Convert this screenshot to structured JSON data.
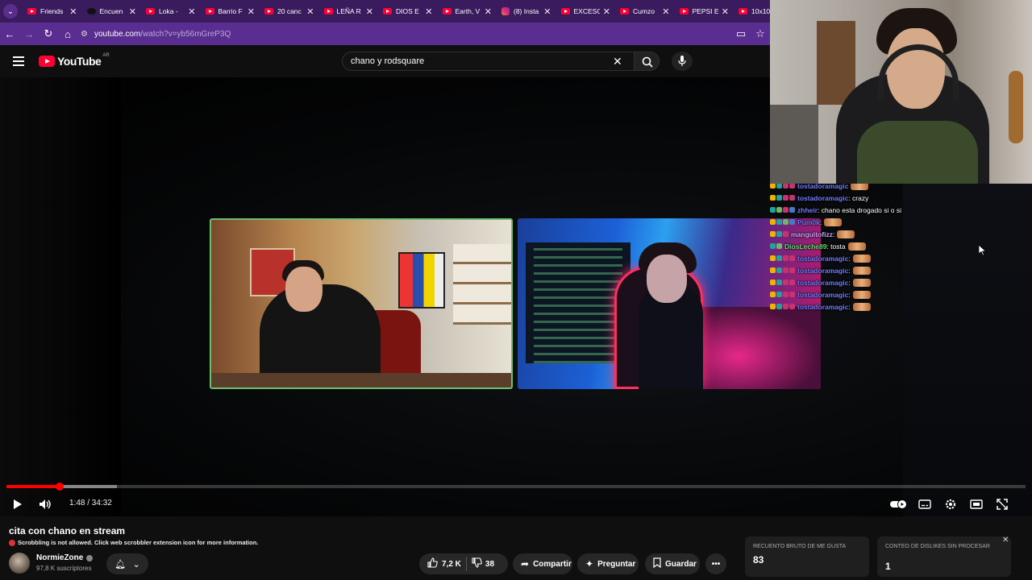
{
  "browser": {
    "tabs": [
      {
        "label": "Friends",
        "icon": "youtube-icon"
      },
      {
        "label": "Encuen",
        "icon": "tiktok-icon"
      },
      {
        "label": "Loka - ",
        "icon": "youtube-icon"
      },
      {
        "label": "Barrio F",
        "icon": "youtube-icon"
      },
      {
        "label": "20 canc",
        "icon": "youtube-icon"
      },
      {
        "label": "LEÑA R",
        "icon": "youtube-icon"
      },
      {
        "label": "DIOS E",
        "icon": "youtube-icon"
      },
      {
        "label": "Earth, V",
        "icon": "youtube-icon"
      },
      {
        "label": "(8) Insta",
        "icon": "instagram-icon"
      },
      {
        "label": "EXCESO",
        "icon": "youtube-icon"
      },
      {
        "label": "Cumzo",
        "icon": "youtube-icon"
      },
      {
        "label": "PEPSI E",
        "icon": "youtube-icon"
      },
      {
        "label": "10x10",
        "icon": "youtube-icon"
      }
    ],
    "url_host": "youtube.com",
    "url_path": "/watch?v=yb56mGreP3Q"
  },
  "masthead": {
    "logo_text": "YouTube",
    "country": "AR",
    "search_value": "chano y rodsquare"
  },
  "chat": [
    {
      "user": "tostadoramagic",
      "color": "#6f7cff",
      "message": "",
      "emote": true,
      "badges": [
        "y",
        "t",
        "p",
        "p"
      ]
    },
    {
      "user": "tostadoramagic",
      "color": "#6f7cff",
      "message": ": crazy",
      "emote": false,
      "badges": [
        "y",
        "t",
        "p",
        "p"
      ]
    },
    {
      "user": "zhheir",
      "color": "#6f7cff",
      "message": ": chano esta drogado si o si",
      "emote": false,
      "badges": [
        "t",
        "g",
        "p",
        "b"
      ]
    },
    {
      "user": "Pum0k",
      "color": "#6f7cff",
      "message": ":",
      "emote": true,
      "badges": [
        "y",
        "t",
        "g",
        "b"
      ]
    },
    {
      "user": "manguitofizz",
      "color": "#c9a7ff",
      "message": ":",
      "emote": true,
      "badges": [
        "y",
        "t",
        "p"
      ]
    },
    {
      "user": "DiosLeche89",
      "color": "#5fe06a",
      "message": ": tosta",
      "emote": true,
      "badges": [
        "t",
        "g"
      ]
    },
    {
      "user": "tostadoramagic",
      "color": "#6f7cff",
      "message": ":",
      "emote": true,
      "badges": [
        "y",
        "t",
        "p",
        "p"
      ]
    },
    {
      "user": "tostadoramagic",
      "color": "#6f7cff",
      "message": ":",
      "emote": true,
      "badges": [
        "y",
        "t",
        "p",
        "p"
      ]
    },
    {
      "user": "tostadoramagic",
      "color": "#6f7cff",
      "message": ":",
      "emote": true,
      "badges": [
        "y",
        "t",
        "p",
        "p"
      ]
    },
    {
      "user": "tostadoramagic",
      "color": "#6f7cff",
      "message": ":",
      "emote": true,
      "badges": [
        "y",
        "t",
        "p",
        "p"
      ]
    },
    {
      "user": "tostadoramagic",
      "color": "#6f7cff",
      "message": ":",
      "emote": true,
      "badges": [
        "y",
        "t",
        "p",
        "p"
      ]
    }
  ],
  "player": {
    "current_time": "1:48",
    "duration": "34:32",
    "time_text": "1:48 / 34:32",
    "played_fraction": 0.052,
    "loaded_fraction": 0.108,
    "progress_color": "#ff0000"
  },
  "video": {
    "title": "cita con chano en stream",
    "scrobble_notice": "Scrobbling is not allowed. Click web scrobbler extension icon for more information.",
    "channel": "NormieZone",
    "subscribers": "97,8 K suscriptores",
    "likes": "7,2 K",
    "dislikes": "38",
    "share_label": "Compartir",
    "ask_label": "Preguntar",
    "save_label": "Guardar"
  },
  "stats": {
    "likes_label": "Recuento bruto de me gusta",
    "likes_value": "83",
    "dislikes_label": "Conteo de dislikes sin procesar",
    "dislikes_value": "1"
  }
}
